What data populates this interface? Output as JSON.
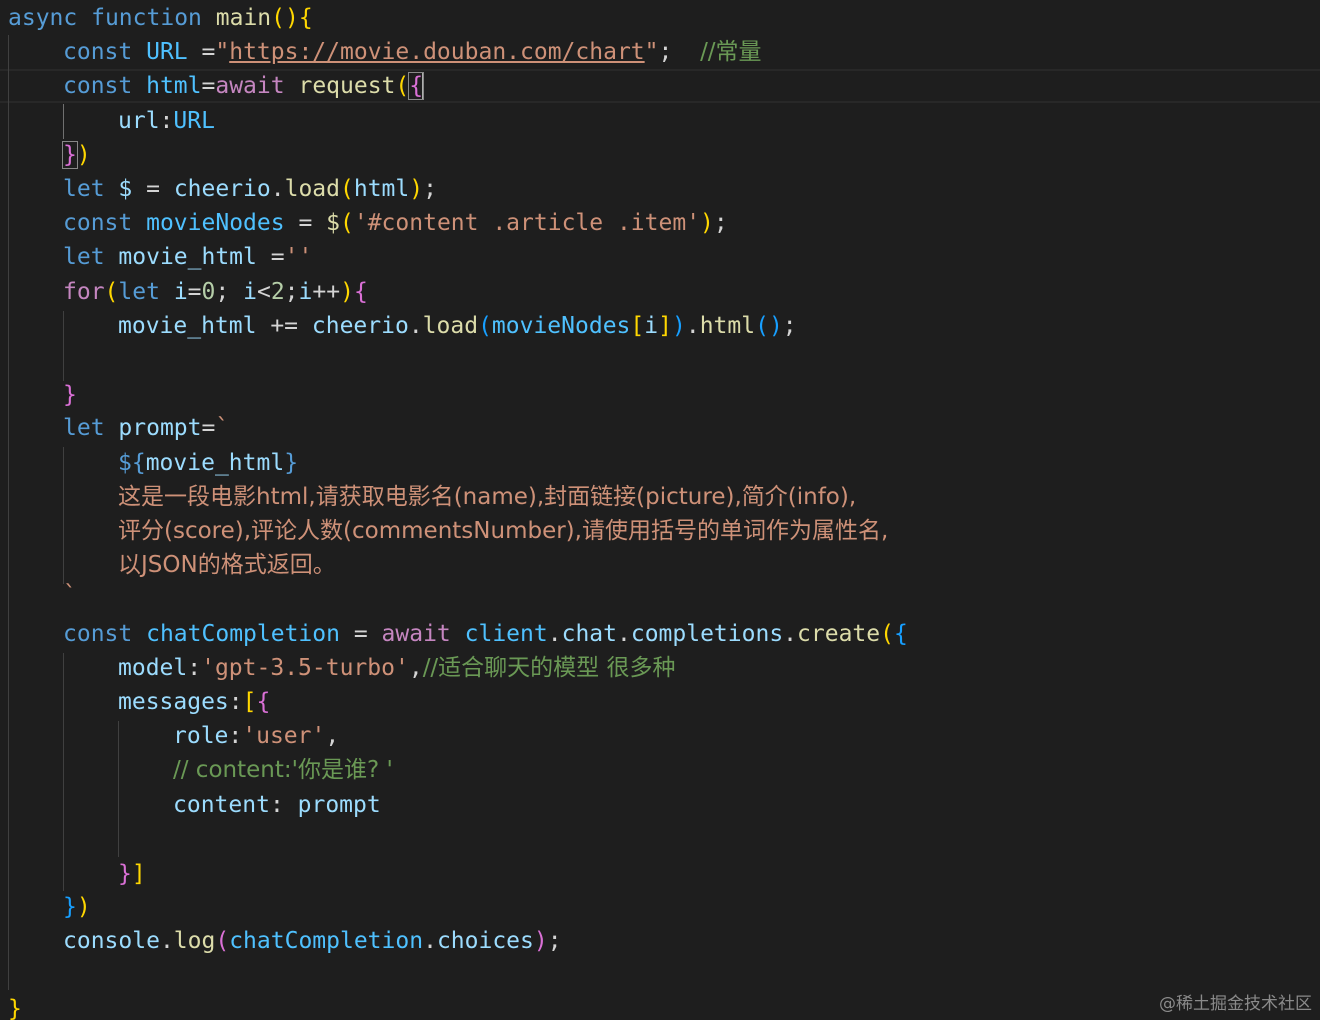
{
  "code": {
    "l1": {
      "kw": "async",
      "fn_kw": "function",
      "name": "main",
      "open": "(){"
    },
    "l2": {
      "kw": "const",
      "name": "URL",
      "eq": " =",
      "q1": "\"",
      "url": "https://movie.douban.com/chart",
      "q2": "\"",
      "semi": ";",
      "comment": "//常量"
    },
    "l3": {
      "kw": "const",
      "name": "html",
      "eq": "=",
      "await": "await",
      "fn": "request",
      "paren": "(",
      "brace": "{"
    },
    "l4": {
      "key": "url",
      "colon": ":",
      "val": "URL"
    },
    "l5": {
      "brace": "}",
      "paren": ")"
    },
    "l6": {
      "kw": "let",
      "name": "$",
      "eq": " = ",
      "obj": "cheerio",
      "dot": ".",
      "fn": "load",
      "paren_open": "(",
      "arg": "html",
      "paren_close": ")",
      "semi": ";"
    },
    "l7": {
      "kw": "const",
      "name": "movieNodes",
      "eq": " = ",
      "fn": "$",
      "paren_open": "(",
      "str": "'#content .article .item'",
      "paren_close": ")",
      "semi": ";"
    },
    "l8": {
      "kw": "let",
      "name": "movie_html",
      "eq": " =",
      "str": "''"
    },
    "l9": {
      "kw": "for",
      "paren_open": "(",
      "let": "let",
      "var_i": "i",
      "eq": "=",
      "zero": "0",
      "semi1": "; ",
      "var_i2": "i",
      "lt": "<",
      "two": "2",
      "semi2": ";",
      "var_i3": "i",
      "inc": "++",
      "paren_close": ")",
      "brace": "{"
    },
    "l10": {
      "name": "movie_html",
      "op": " += ",
      "obj": "cheerio",
      "dot": ".",
      "fn": "load",
      "p_open": "(",
      "arr": "movieNodes",
      "b_open": "[",
      "idx": "i",
      "b_close": "]",
      "p_close": ")",
      "dot2": ".",
      "fn2": "html",
      "call": "()",
      "semi": ";"
    },
    "l12": {
      "brace": "}"
    },
    "l13": {
      "kw": "let",
      "name": "prompt",
      "eq": "=",
      "tick": "`"
    },
    "l14": {
      "open": "${",
      "var": "movie_html",
      "close": "}"
    },
    "l15": "这是一段电影html,请获取电影名(name),封面链接(picture),简介(info),",
    "l16": "评分(score),评论人数(commentsNumber),请使用括号的单词作为属性名,",
    "l17": "以JSON的格式返回。",
    "l18": "`",
    "l20": {
      "kw": "const",
      "name": "chatCompletion",
      "eq": " = ",
      "await": "await",
      "obj": "client",
      "dot1": ".",
      "p1": "chat",
      "dot2": ".",
      "p2": "completions",
      "dot3": ".",
      "fn": "create",
      "paren": "(",
      "brace": "{"
    },
    "l21": {
      "key": "model",
      "colon": ":",
      "str": "'gpt-3.5-turbo'",
      "comma": ",",
      "comment": "//适合聊天的模型 很多种"
    },
    "l22": {
      "key": "messages",
      "colon": ":",
      "bracket": "[",
      "brace": "{"
    },
    "l23": {
      "key": "role",
      "colon": ":",
      "str": "'user'",
      "comma": ","
    },
    "l24": "// content:'你是谁? '",
    "l25": {
      "key": "content",
      "colon": ": ",
      "val": "prompt"
    },
    "l27": {
      "brace": "}",
      "bracket": "]"
    },
    "l28": {
      "brace": "}",
      "paren": ")"
    },
    "l29": {
      "obj": "console",
      "dot": ".",
      "fn": "log",
      "p_open": "(",
      "arg": "chatCompletion",
      "dot2": ".",
      "prop": "choices",
      "p_close": ")",
      "semi": ";"
    },
    "l31": {
      "brace": "}"
    }
  },
  "watermark": "@稀土掘金技术社区",
  "colors": {
    "background": "#1e1e1e",
    "keyword": "#569cd6",
    "control": "#c586c0",
    "variable": "#9cdcfe",
    "constant": "#4fc1ff",
    "function": "#dcdcaa",
    "string": "#ce9178",
    "number": "#b5cea8",
    "comment": "#6a9955",
    "bracket_gold": "#ffd700",
    "bracket_orchid": "#da70d6",
    "bracket_blue": "#179fff"
  }
}
